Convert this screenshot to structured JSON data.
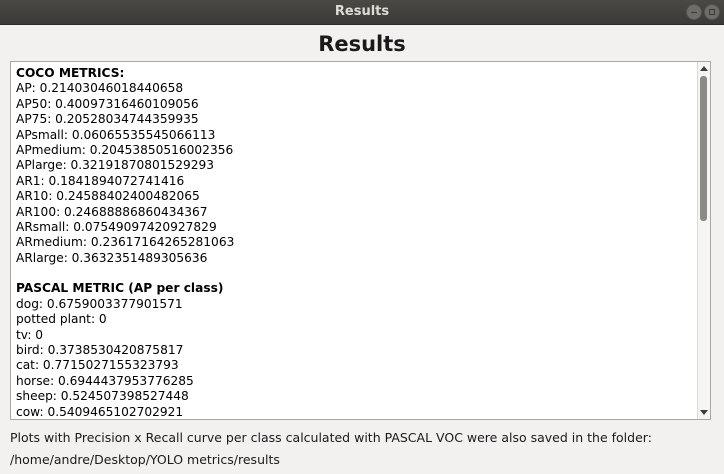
{
  "window": {
    "title": "Results"
  },
  "heading": "Results",
  "coco": {
    "header": "COCO METRICS:",
    "lines": [
      "AP: 0.21403046018440658",
      "AP50: 0.40097316460109056",
      "AP75: 0.20528034744359935",
      "APsmall: 0.06065535545066113",
      "APmedium: 0.20453850516002356",
      "APlarge: 0.32191870801529293",
      "AR1: 0.1841894072741416",
      "AR10: 0.24588402400482065",
      "AR100: 0.24688886860434367",
      "ARsmall: 0.07549097420927829",
      "ARmedium: 0.23617164265281063",
      "ARlarge: 0.3632351489305636"
    ]
  },
  "pascal": {
    "header": "PASCAL METRIC (AP per class)",
    "lines": [
      "dog: 0.6759003377901571",
      "potted plant: 0",
      "tv: 0",
      "bird: 0.3738530420875817",
      "cat: 0.7715027155323793",
      "horse: 0.6944437953776285",
      "sheep: 0.524507398527448",
      "cow: 0.5409465102702921"
    ]
  },
  "footer": {
    "line1": "Plots with Precision x Recall  curve per class calculated with PASCAL VOC were also saved in the folder:",
    "line2": "/home/andre/Desktop/YOLO metrics/results"
  },
  "icons": {
    "minimize": "minimize-icon",
    "maximize": "maximize-icon",
    "scroll_up": "scroll-up-arrow-icon",
    "scroll_down": "scroll-down-arrow-icon"
  }
}
